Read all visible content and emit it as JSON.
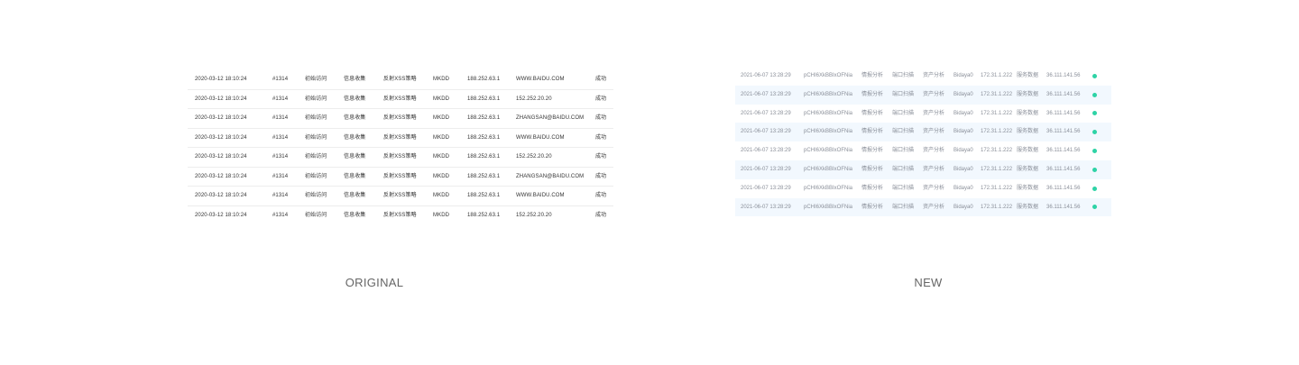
{
  "original": {
    "caption": "ORIGINAL",
    "rows": [
      [
        "2020-03-12 18:10:24",
        "#1314",
        "初始访问",
        "信息收集",
        "反射XSS策略",
        "MKDD",
        "188.252.63.1",
        "WWW.BAIDU.COM",
        "成功"
      ],
      [
        "2020-03-12 18:10:24",
        "#1314",
        "初始访问",
        "信息收集",
        "反射XSS策略",
        "MKDD",
        "188.252.63.1",
        "152.252.20.20",
        "成功"
      ],
      [
        "2020-03-12 18:10:24",
        "#1314",
        "初始访问",
        "信息收集",
        "反射XSS策略",
        "MKDD",
        "188.252.63.1",
        "ZHANGSAN@BAIDU.COM",
        "成功"
      ],
      [
        "2020-03-12 18:10:24",
        "#1314",
        "初始访问",
        "信息收集",
        "反射XSS策略",
        "MKDD",
        "188.252.63.1",
        "WWW.BAIDU.COM",
        "成功"
      ],
      [
        "2020-03-12 18:10:24",
        "#1314",
        "初始访问",
        "信息收集",
        "反射XSS策略",
        "MKDD",
        "188.252.63.1",
        "152.252.20.20",
        "成功"
      ],
      [
        "2020-03-12 18:10:24",
        "#1314",
        "初始访问",
        "信息收集",
        "反射XSS策略",
        "MKDD",
        "188.252.63.1",
        "ZHANGSAN@BAIDU.COM",
        "成功"
      ],
      [
        "2020-03-12 18:10:24",
        "#1314",
        "初始访问",
        "信息收集",
        "反射XSS策略",
        "MKDD",
        "188.252.63.1",
        "WWW.BAIDU.COM",
        "成功"
      ],
      [
        "2020-03-12 18:10:24",
        "#1314",
        "初始访问",
        "信息收集",
        "反射XSS策略",
        "MKDD",
        "188.252.63.1",
        "152.252.20.20",
        "成功"
      ]
    ]
  },
  "new": {
    "caption": "NEW",
    "status_color": "#2ed3a6",
    "alt_row_color": "#f2f8fe",
    "rows": [
      [
        "2021-06-07 13:28:29",
        "pCHI6XkBBIxOFNia",
        "情报分析",
        "端口扫描",
        "资产分析",
        "Bidaya0",
        "172.31.1.222",
        "服务数据",
        "36.111.141.56"
      ],
      [
        "2021-06-07 13:28:29",
        "pCHI6XkBBIxOFNia",
        "情报分析",
        "端口扫描",
        "资产分析",
        "Bidaya0",
        "172.31.1.222",
        "服务数据",
        "36.111.141.56"
      ],
      [
        "2021-06-07 13:28:29",
        "pCHI6XkBBIxOFNia",
        "情报分析",
        "端口扫描",
        "资产分析",
        "Bidaya0",
        "172.31.1.222",
        "服务数据",
        "36.111.141.56"
      ],
      [
        "2021-06-07 13:28:29",
        "pCHI6XkBBIxOFNia",
        "情报分析",
        "端口扫描",
        "资产分析",
        "Bidaya0",
        "172.31.1.222",
        "服务数据",
        "36.111.141.56"
      ],
      [
        "2021-06-07 13:28:29",
        "pCHI6XkBBIxOFNia",
        "情报分析",
        "端口扫描",
        "资产分析",
        "Bidaya0",
        "172.31.1.222",
        "服务数据",
        "36.111.141.56"
      ],
      [
        "2021-06-07 13:28:29",
        "pCHI6XkBBIxOFNia",
        "情报分析",
        "端口扫描",
        "资产分析",
        "Bidaya0",
        "172.31.1.222",
        "服务数据",
        "36.111.141.56"
      ],
      [
        "2021-06-07 13:28:29",
        "pCHI6XkBBIxOFNia",
        "情报分析",
        "端口扫描",
        "资产分析",
        "Bidaya0",
        "172.31.1.222",
        "服务数据",
        "36.111.141.56"
      ],
      [
        "2021-06-07 13:28:29",
        "pCHI6XkBBIxOFNia",
        "情报分析",
        "端口扫描",
        "资产分析",
        "Bidaya0",
        "172.31.1.222",
        "服务数据",
        "36.111.141.56"
      ]
    ]
  }
}
